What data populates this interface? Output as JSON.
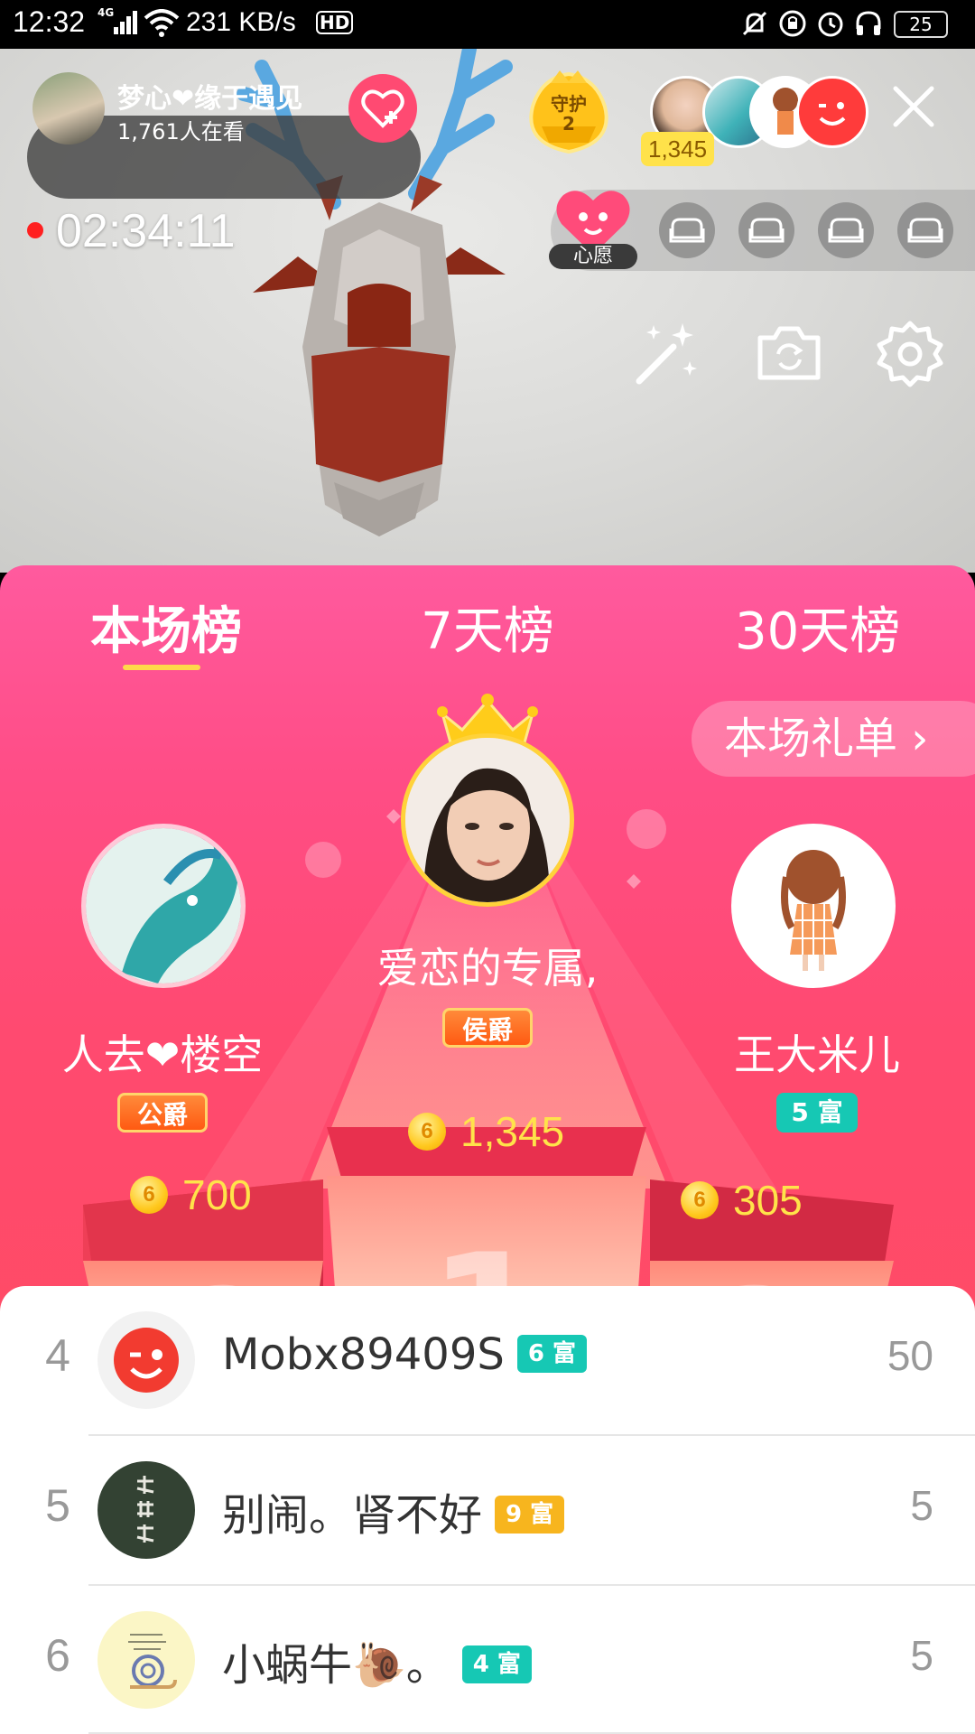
{
  "status_bar": {
    "time": "12:32",
    "network": "4G",
    "speed": "231 KB/s",
    "hd": "HD",
    "battery": "25"
  },
  "host": {
    "name": "梦心❤缘于遇见",
    "viewers": "1,761人在看",
    "follow_icon": "heart-plus-icon"
  },
  "guard": {
    "label": "守护",
    "count": "2"
  },
  "top_viewers": {
    "coins": "1,345"
  },
  "stream": {
    "timer": "02:34:11",
    "wish_label": "心愿"
  },
  "tabs": [
    {
      "label": "本场榜"
    },
    {
      "label": "7天榜"
    },
    {
      "label": "30天榜"
    }
  ],
  "gift_list_button": "本场礼单 ›",
  "podium": {
    "first": {
      "name": "爱恋的专属,",
      "badge": "侯爵",
      "amount": "1,345"
    },
    "second": {
      "name": "人去❤楼空",
      "badge": "公爵",
      "amount": "700"
    },
    "third": {
      "name": "王大米儿",
      "badge": "5 富",
      "amount": "305"
    },
    "coin_symbol": "6"
  },
  "ranking": [
    {
      "rank": "4",
      "name": "Mobx89409S",
      "rich": "6 富",
      "rich_color": "#16c8b4",
      "score": "50"
    },
    {
      "rank": "5",
      "name": "别闹。肾不好",
      "rich": "9 富",
      "rich_color": "#f7b51e",
      "score": "5"
    },
    {
      "rank": "6",
      "name": "小蜗牛🐌。",
      "rich": "4 富",
      "rich_color": "#16c8b4",
      "score": "5"
    }
  ],
  "colors": {
    "accent_pink": "#ff4a72",
    "tab_underline": "#ffd84a",
    "gold_text": "#ffe34a"
  }
}
